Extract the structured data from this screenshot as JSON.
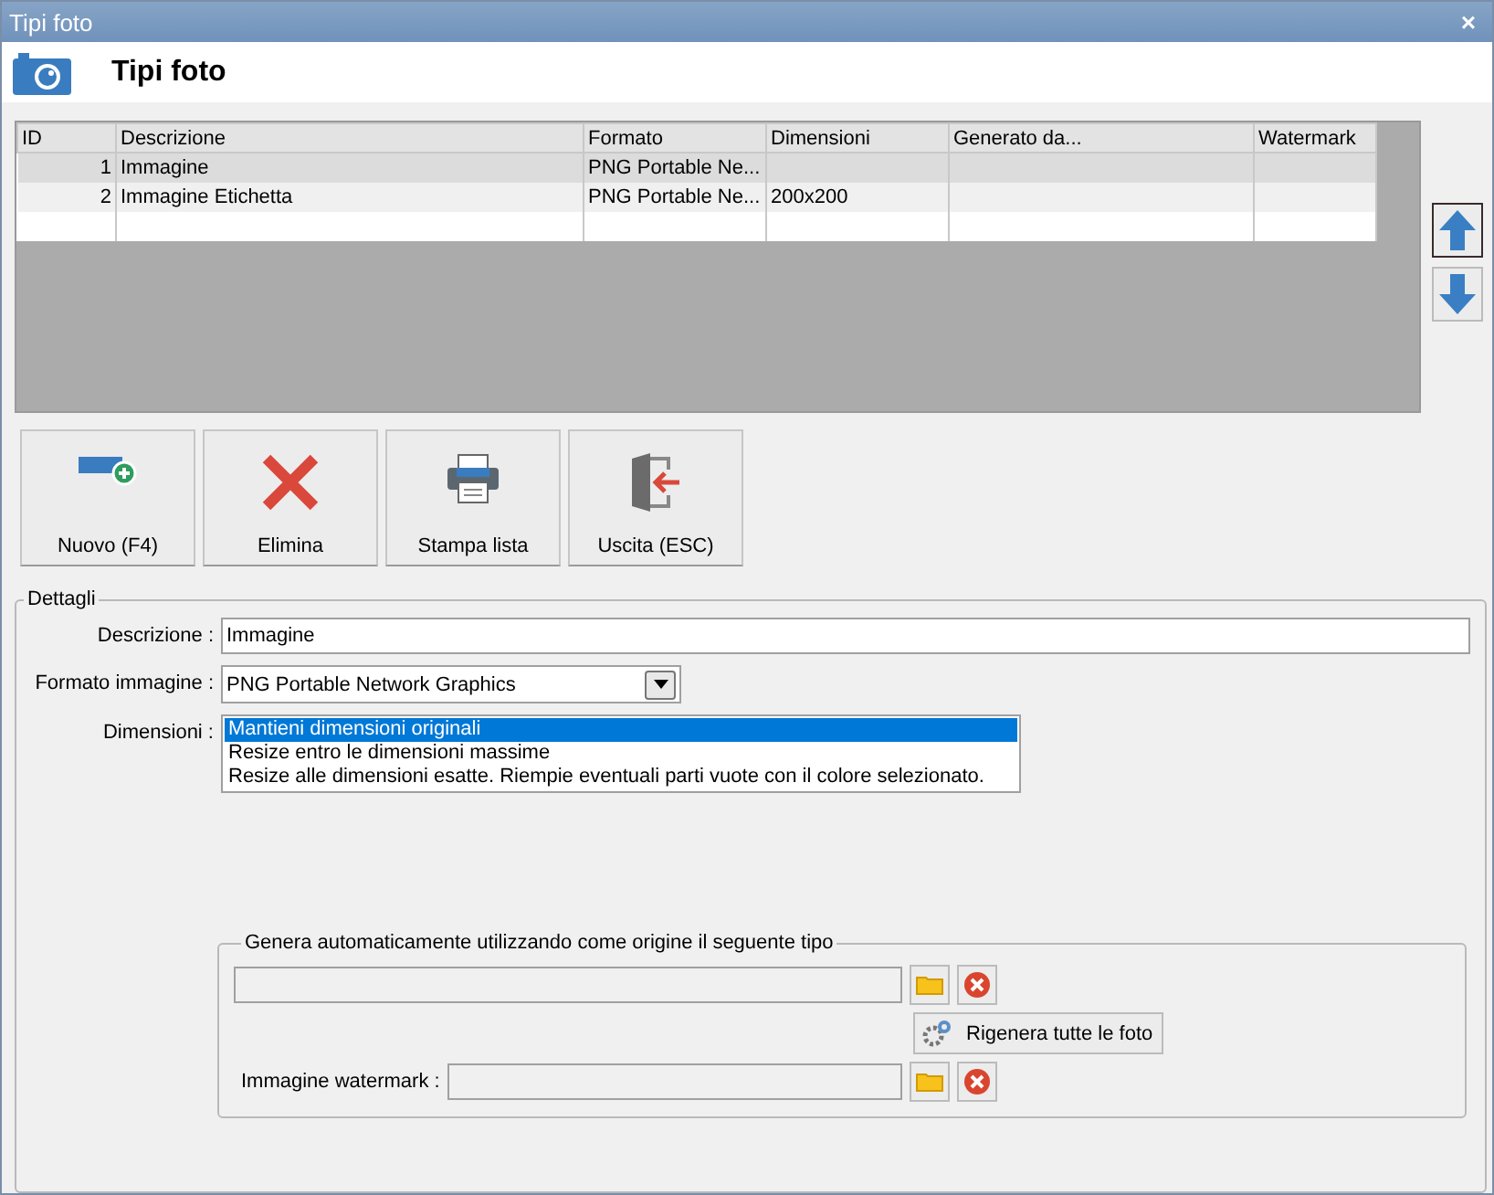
{
  "window": {
    "title": "Tipi foto",
    "close": "×"
  },
  "header": {
    "title": "Tipi foto"
  },
  "table": {
    "columns": [
      "ID",
      "Descrizione",
      "Formato",
      "Dimensioni",
      "Generato da...",
      "Watermark"
    ],
    "rows": [
      {
        "selected": true,
        "cells": [
          "1",
          "Immagine",
          "PNG Portable Ne...",
          "",
          "",
          ""
        ]
      },
      {
        "selected": false,
        "cells": [
          "2",
          "Immagine Etichetta",
          "PNG Portable Ne...",
          "200x200",
          "",
          ""
        ]
      }
    ]
  },
  "toolbar": [
    {
      "kind": "new",
      "label": "Nuovo (F4)"
    },
    {
      "kind": "delete",
      "label": "Elimina"
    },
    {
      "kind": "print",
      "label": "Stampa lista"
    },
    {
      "kind": "exit",
      "label": "Uscita (ESC)"
    }
  ],
  "details": {
    "title": "Dettagli",
    "descrizione": {
      "label": "Descrizione :",
      "value": "Immagine"
    },
    "formato": {
      "label": "Formato immagine :",
      "value": "PNG Portable Network Graphics"
    },
    "dimensioni": {
      "label": "Dimensioni :",
      "options": [
        {
          "label": "Mantieni dimensioni originali",
          "selected": true
        },
        {
          "label": "Resize entro le dimensioni massime",
          "selected": false
        },
        {
          "label": "Resize alle dimensioni esatte. Riempie eventuali parti vuote con il colore selezionato.",
          "selected": false
        }
      ]
    },
    "genera": {
      "title": "Genera automaticamente utilizzando come origine il seguente tipo",
      "regenerate": "Rigenera tutte le foto",
      "watermark_label": "Immagine watermark :"
    }
  }
}
